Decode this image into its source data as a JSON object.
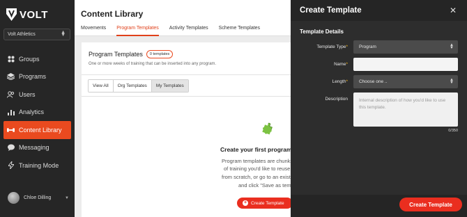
{
  "brand": {
    "name": "VOLT",
    "accent": "#ea4a1f"
  },
  "org_selector": {
    "value": "Volt Athletics"
  },
  "nav": [
    {
      "label": "Groups",
      "icon": "groups-icon"
    },
    {
      "label": "Programs",
      "icon": "layers-icon"
    },
    {
      "label": "Users",
      "icon": "users-icon"
    },
    {
      "label": "Analytics",
      "icon": "bar-chart-icon"
    },
    {
      "label": "Content Library",
      "icon": "dumbbell-icon",
      "active": true
    },
    {
      "label": "Messaging",
      "icon": "chat-bubble-icon"
    },
    {
      "label": "Training Mode",
      "icon": "lightning-icon"
    }
  ],
  "user": {
    "name": "Chloe Dilling"
  },
  "main": {
    "title": "Content Library",
    "tabs": [
      "Movements",
      "Program Templates",
      "Activity Templates",
      "Scheme Templates"
    ],
    "active_tab": "Program Templates",
    "card": {
      "title": "Program Templates",
      "badge": "0 templates",
      "subtitle": "One or more weeks of training that can be inserted into any program.",
      "filters": [
        "View All",
        "Org Templates",
        "My Templates"
      ],
      "active_filter": "My Templates",
      "empty_title": "Create your first program",
      "empty_lines": [
        "Program templates are chunks",
        "of training you'd like to reuse.",
        "from scratch, or go to an exist",
        "and click \"Save as temp"
      ],
      "create_label": "Create Template"
    }
  },
  "drawer": {
    "title": "Create Template",
    "section": "Template Details",
    "fields": {
      "template_type": {
        "label": "Template Type",
        "value": "Program"
      },
      "name": {
        "label": "Name",
        "value": ""
      },
      "length": {
        "label": "Length",
        "value": "Choose one .."
      },
      "description": {
        "label": "Description",
        "placeholder": "Internal description of how you'd like to use this template."
      }
    },
    "counter": "0/350",
    "submit_label": "Create Template"
  }
}
